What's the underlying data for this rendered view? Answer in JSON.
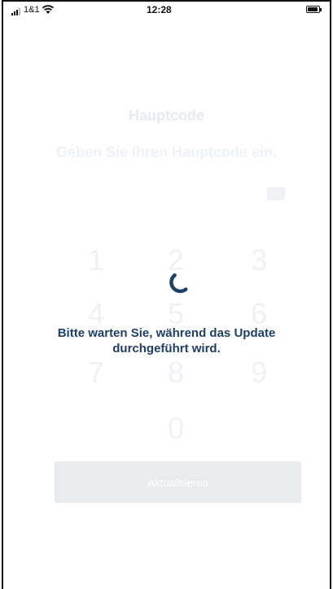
{
  "status_bar": {
    "carrier": "1&1",
    "time": "12:28",
    "signal_bars_filled": 3,
    "signal_bars_total": 4,
    "wifi_icon": "wifi-icon",
    "battery_icon": "battery-icon"
  },
  "screen": {
    "title": "Hauptcode",
    "subtitle": "Geben Sie Ihren Hauptcode ein.",
    "visibility_icon": "eye-icon",
    "keypad": [
      "1",
      "2",
      "3",
      "4",
      "5",
      "6",
      "7",
      "8",
      "9",
      "0"
    ],
    "update_button_label": "Aktualisieren"
  },
  "overlay": {
    "spinner_icon": "loading-spinner-icon",
    "message": "Bitte warten Sie, während das Update durchgeführt wird."
  },
  "colors": {
    "message_text": "#1f3f66",
    "spinner": "#1f3f66",
    "faded_text": "#e4eaf2",
    "faded_button": "#e7ecf1"
  }
}
